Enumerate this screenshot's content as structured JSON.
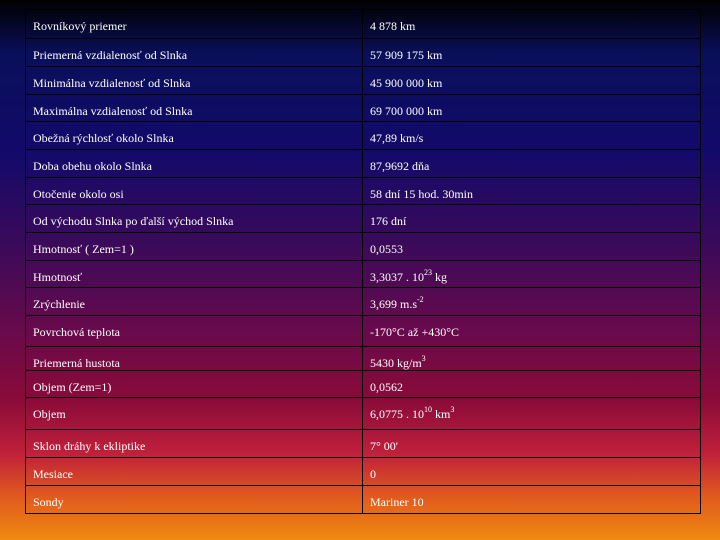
{
  "rows": [
    {
      "label": "Rovníkový priemer",
      "value": "4 878 km"
    },
    {
      "label": "Priemerná vzdialenosť od Slnka",
      "value": "57 909 175 km"
    },
    {
      "label": "Minimálna vzdialenosť od Slnka",
      "value": "45 900 000 km"
    },
    {
      "label": "Maximálna vzdialenosť od Slnka",
      "value": "69 700 000 km"
    },
    {
      "label": "Obežná rýchlosť okolo Slnka",
      "value": "47,89 km/s"
    },
    {
      "label": "Doba obehu okolo Slnka",
      "value": "87,9692 dňa"
    },
    {
      "label": "Otočenie okolo osi",
      "value": "58 dní 15 hod. 30min"
    },
    {
      "label": "Od východu Slnka po ďalší východ Slnka",
      "value": "176 dní"
    },
    {
      "label": "Hmotnosť ( Zem=1 )",
      "value": "0,0553"
    },
    {
      "label": "Hmotnosť",
      "value_main": "3,3037 . 10",
      "value_sup": "23",
      "value_tail": " kg"
    },
    {
      "label": "Zrýchlenie",
      "value_main": "3,699 m.s",
      "value_sup": "-2",
      "value_tail": ""
    },
    {
      "label": "Povrchová teplota",
      "value": "-170°C až +430°C"
    },
    {
      "label": "Priemerná hustota",
      "value_main": "5430 kg/m",
      "value_sup": "3",
      "value_tail": ""
    },
    {
      "label": "Objem (Zem=1)",
      "value": "0,0562"
    },
    {
      "label": "Objem",
      "value_main": "6,0775 . 10",
      "value_sup": "10",
      "value_tail": " km",
      "value_sup2": "3"
    },
    {
      "label": "Sklon dráhy k ekliptike",
      "value": "7° 00'"
    },
    {
      "label": "Mesiace",
      "value": "0"
    },
    {
      "label": "Sondy",
      "value": "Mariner 10"
    }
  ]
}
